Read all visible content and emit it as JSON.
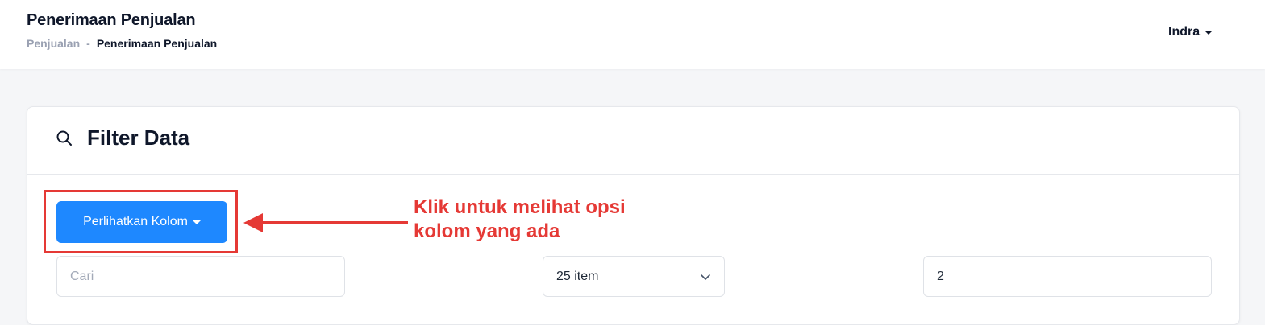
{
  "header": {
    "title": "Penerimaan Penjualan",
    "breadcrumb": {
      "parent": "Penjualan",
      "separator": "-",
      "current": "Penerimaan Penjualan"
    },
    "user": "Indra"
  },
  "filter_card": {
    "title": "Filter Data",
    "icon": "search-icon",
    "columns_button": "Perlihatkan Kolom",
    "search": {
      "placeholder": "Cari",
      "value": ""
    },
    "page_size": {
      "selected": "25 item"
    },
    "page_number": {
      "value": "2"
    }
  },
  "annotation": {
    "text_line1": "Klik untuk melihat opsi",
    "text_line2": "kolom yang ada",
    "color": "#e53935"
  },
  "colors": {
    "primary": "#1e88ff",
    "text": "#0f172a",
    "muted": "#9aa1b2"
  }
}
